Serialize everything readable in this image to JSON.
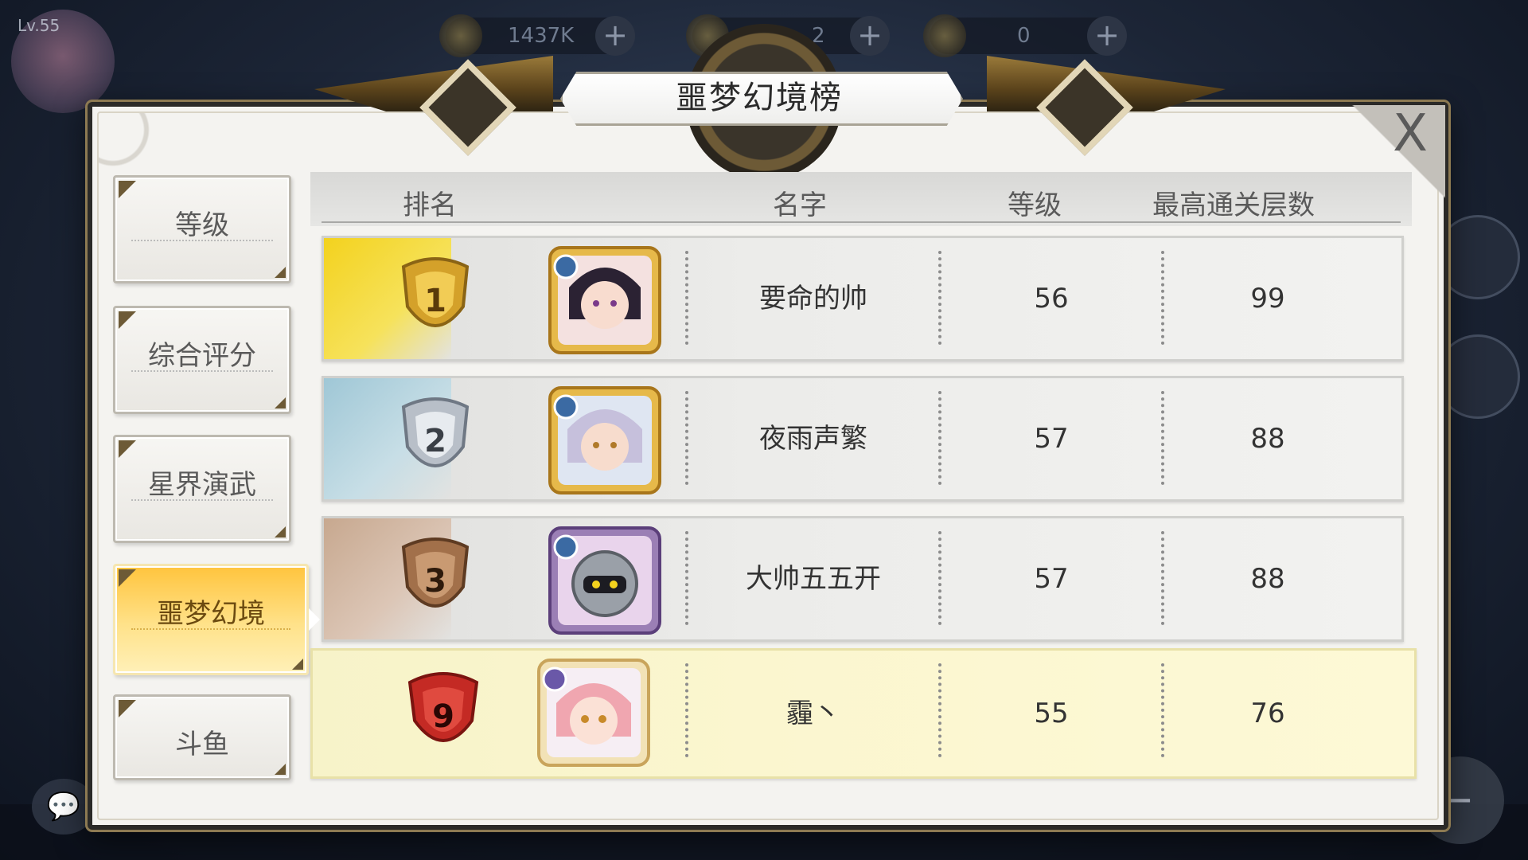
{
  "hud": {
    "level": "Lv.55",
    "resources": [
      {
        "name": "gold",
        "value": "1437K"
      },
      {
        "name": "gem",
        "value": "2"
      },
      {
        "name": "token",
        "value": "0"
      }
    ],
    "plus_label": "+"
  },
  "panel": {
    "title": "噩梦幻境榜",
    "close_label": "X"
  },
  "tabs": [
    {
      "label": "等级",
      "active": false
    },
    {
      "label": "综合评分",
      "active": false
    },
    {
      "label": "星界演武",
      "active": false
    },
    {
      "label": "噩梦幻境",
      "active": true
    },
    {
      "label": "斗鱼",
      "active": false
    }
  ],
  "table": {
    "headers": {
      "rank": "排名",
      "name": "名字",
      "level": "等级",
      "floors": "最高通关层数"
    },
    "rows": [
      {
        "rank": "1",
        "name": "要命的帅",
        "level": "56",
        "floors": "99",
        "badge": "gold-crest",
        "color": "#f3d21e"
      },
      {
        "rank": "2",
        "name": "夜雨声繁",
        "level": "57",
        "floors": "88",
        "badge": "silver-crest",
        "color": "#9fc7d6"
      },
      {
        "rank": "3",
        "name": "大帅五五开",
        "level": "57",
        "floors": "88",
        "badge": "bronze-crest",
        "color": "#c7a88f"
      },
      {
        "rank": "9",
        "name": "霾丶",
        "level": "55",
        "floors": "76",
        "badge": "red-crest",
        "color": "#c42a24",
        "is_self": true
      }
    ]
  },
  "colors": {
    "gold": "#d4a12a",
    "silver": "#b8bfc8",
    "bronze": "#a2704a",
    "self_row": "#fbf6cf",
    "active_tab": "#ffc43d"
  }
}
